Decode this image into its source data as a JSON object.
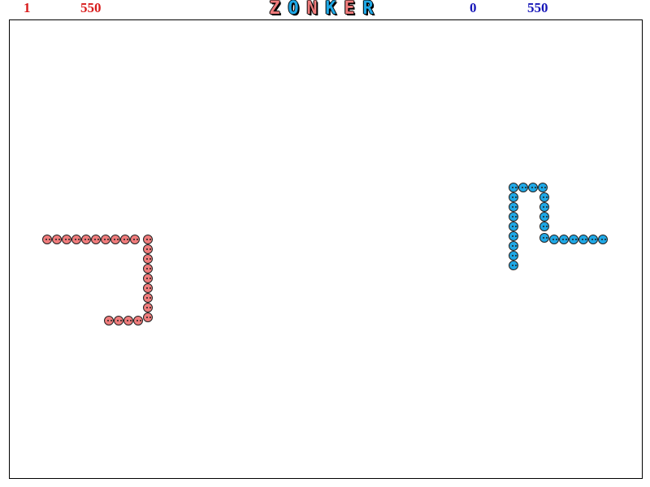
{
  "hud": {
    "player1": {
      "lives": "1",
      "score": "550",
      "color": "#d81b1b"
    },
    "player2": {
      "lives": "0",
      "score": "550",
      "color": "#1515b8"
    }
  },
  "title": {
    "letters": [
      "Z",
      "O",
      "N",
      "K",
      "E",
      "R"
    ],
    "letter_colors": [
      "#f07c7c",
      "#1fa8e6",
      "#f07c7c",
      "#1fa8e6",
      "#f07c7c",
      "#1fa8e6"
    ]
  },
  "snakes": [
    {
      "name": "red-snake",
      "color": "#f07c7c",
      "segment_count": 25
    },
    {
      "name": "blue-snake",
      "color": "#1fa8e6",
      "segment_count": 24
    }
  ]
}
